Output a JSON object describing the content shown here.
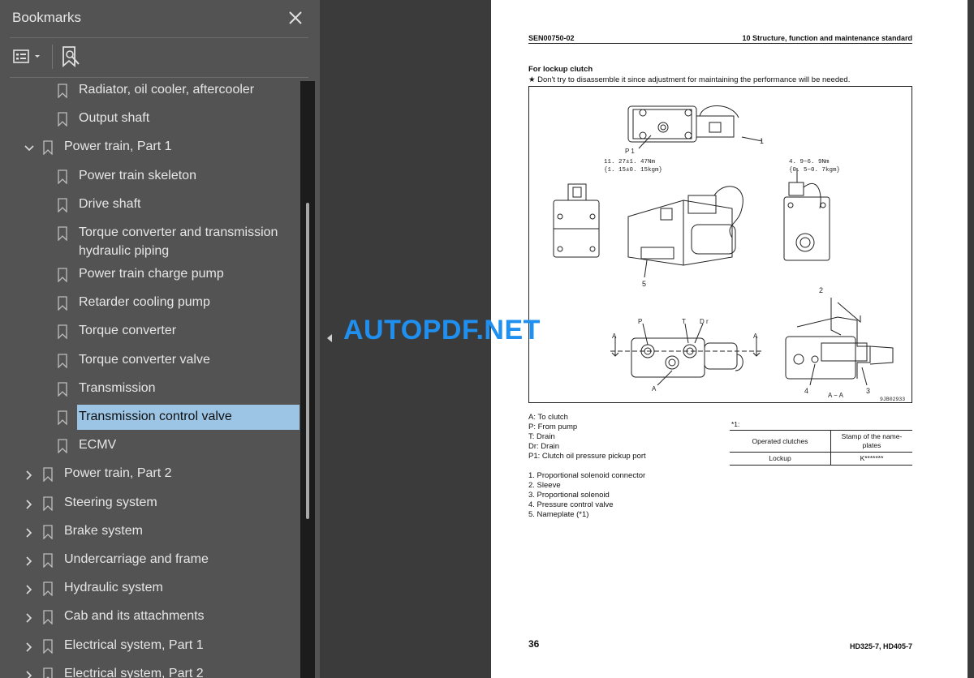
{
  "sidebar": {
    "title": "Bookmarks",
    "close_icon": "close-icon",
    "options_icon": "list-options-icon",
    "add_bookmark_icon": "bookmark-search-icon",
    "items": [
      {
        "label": "Radiator, oil cooler, aftercooler",
        "level": 2,
        "expander": "none"
      },
      {
        "label": "Output shaft",
        "level": 2,
        "expander": "none"
      },
      {
        "label": "Power train, Part 1",
        "level": 1,
        "expander": "expanded"
      },
      {
        "label": "Power train skeleton",
        "level": 2,
        "expander": "none"
      },
      {
        "label": "Drive shaft",
        "level": 2,
        "expander": "none"
      },
      {
        "label": "Torque converter and transmission hydraulic piping",
        "level": 2,
        "expander": "none"
      },
      {
        "label": "Power train charge pump",
        "level": 2,
        "expander": "none"
      },
      {
        "label": "Retarder cooling pump",
        "level": 2,
        "expander": "none"
      },
      {
        "label": "Torque converter",
        "level": 2,
        "expander": "none"
      },
      {
        "label": "Torque converter valve",
        "level": 2,
        "expander": "none"
      },
      {
        "label": "Transmission",
        "level": 2,
        "expander": "none"
      },
      {
        "label": "Transmission control valve",
        "level": 2,
        "expander": "none",
        "selected": true
      },
      {
        "label": "ECMV",
        "level": 2,
        "expander": "none"
      },
      {
        "label": "Power train, Part 2",
        "level": 1,
        "expander": "collapsed"
      },
      {
        "label": "Steering system",
        "level": 1,
        "expander": "collapsed"
      },
      {
        "label": "Brake system",
        "level": 1,
        "expander": "collapsed"
      },
      {
        "label": "Undercarriage and frame",
        "level": 1,
        "expander": "collapsed"
      },
      {
        "label": "Hydraulic system",
        "level": 1,
        "expander": "collapsed"
      },
      {
        "label": "Cab and its attachments",
        "level": 1,
        "expander": "collapsed"
      },
      {
        "label": "Electrical system, Part 1",
        "level": 1,
        "expander": "collapsed"
      },
      {
        "label": "Electrical system, Part 2",
        "level": 1,
        "expander": "collapsed"
      }
    ]
  },
  "watermark": "AUTOPDF.NET",
  "page": {
    "doc_code": "SEN00750-02",
    "section_title": "10 Structure, function and maintenance standard",
    "subheading": "For lockup clutch",
    "note": "★   Don't try to disassemble it since adjustment for maintaining the performance will be needed.",
    "figure": {
      "callout_1": "1",
      "callout_2": "2",
      "callout_3": "3",
      "callout_4": "4",
      "callout_5": "5",
      "port_p1": "P 1",
      "torque_left_1": "11. 27±1. 47Nm",
      "torque_left_2": "{1. 15±0. 15kgm}",
      "torque_right_1": "4. 9~6. 9Nm",
      "torque_right_2": "{0. 5~0. 7kgm}",
      "port_p": "P",
      "port_t": "T",
      "port_dr": "D r",
      "port_a_top": "A",
      "section_a_left": "A",
      "section_a_right": "A",
      "section_label": "A − A",
      "fig_id": "9JB02933"
    },
    "legend": [
      "A:    To clutch",
      "P:    From pump",
      "T:    Drain",
      "Dr:  Drain",
      "P1:  Clutch oil pressure pickup port"
    ],
    "parts": [
      "1.    Proportional solenoid connector",
      "2.    Sleeve",
      "3.    Proportional solenoid",
      "4.    Pressure control valve",
      "5.    Nameplate (*1)"
    ],
    "table_note": "*1:",
    "table": {
      "header_col1": "Operated clutches",
      "header_col2_a": "Stamp of the name-",
      "header_col2_b": "plates",
      "row_col1": "Lockup",
      "row_col2": "K*******"
    },
    "page_number": "36",
    "model": "HD325-7, HD405-7"
  }
}
